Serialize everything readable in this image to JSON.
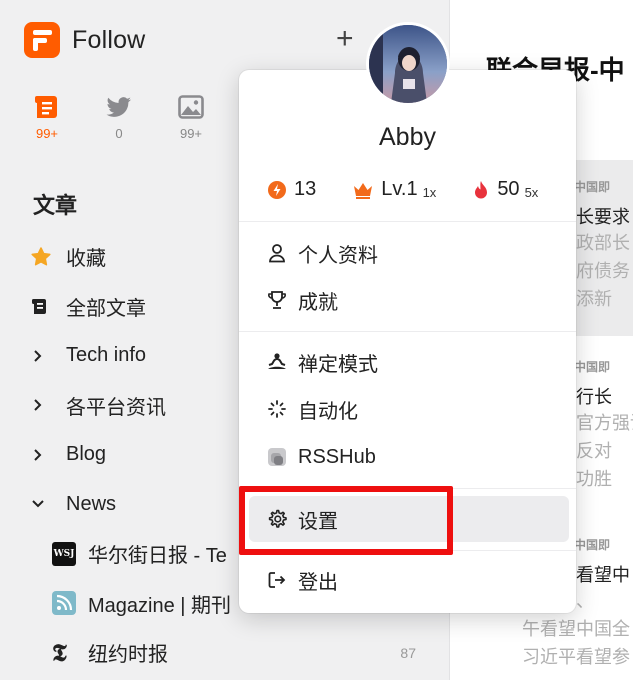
{
  "app": {
    "name": "Follow"
  },
  "views": [
    {
      "icon": "article-icon",
      "count": "99+",
      "active": true
    },
    {
      "icon": "twitter-icon",
      "count": "0"
    },
    {
      "icon": "picture-icon",
      "count": "99+"
    }
  ],
  "sidebar": {
    "section_title": "文章",
    "items": [
      {
        "label": "收藏",
        "icon": "star-icon"
      },
      {
        "label": "全部文章",
        "icon": "scroll-icon"
      },
      {
        "label": "Tech info",
        "icon": "chevron-right-icon"
      },
      {
        "label": "各平台资讯",
        "icon": "chevron-right-icon"
      },
      {
        "label": "Blog",
        "icon": "chevron-right-icon"
      },
      {
        "label": "News",
        "icon": "chevron-down-icon"
      },
      {
        "label": "华尔街日报 - Te",
        "icon": "wsj-icon"
      },
      {
        "label": "Magazine | 期刊",
        "icon": "rss-icon"
      },
      {
        "label": "纽约时报",
        "icon": "nyt-icon",
        "count": "87"
      }
    ]
  },
  "content": {
    "heading": "联合早报-中",
    "articles": [
      {
        "source": "联合早报-中国即",
        "title": "中国财长要求",
        "desc": [
          "中国财政部长",
          "地方政府债务",
          "期间再添新"
        ]
      },
      {
        "source": "联合早报-中国即",
        "title": "国央行行长",
        "desc": [
          "国央行官方强调",
          "经济，反对",
          "银行潘功胜"
        ]
      },
      {
        "source": "联合早报-中国即",
        "title": "习近平看望中",
        "desc": [
          "总书记、",
          "午看望中国全",
          "习近平看望参"
        ]
      }
    ]
  },
  "menu": {
    "user": "Abby",
    "stats": [
      {
        "icon": "power-icon",
        "value": "13",
        "mult": "",
        "color": "#f26a1b"
      },
      {
        "icon": "crown-icon",
        "value": "Lv.1",
        "mult": "1x",
        "color": "#f26a1b"
      },
      {
        "icon": "flame-icon",
        "value": "50",
        "mult": "5x",
        "color": "#e8323c"
      }
    ],
    "items": [
      {
        "label": "个人资料",
        "icon": "user-icon"
      },
      {
        "label": "成就",
        "icon": "trophy-icon"
      },
      {
        "label": "禅定模式",
        "icon": "meditation-icon"
      },
      {
        "label": "自动化",
        "icon": "magic-icon"
      },
      {
        "label": "RSSHub",
        "icon": "rsshub-icon"
      },
      {
        "label": "设置",
        "icon": "gear-icon"
      },
      {
        "label": "登出",
        "icon": "logout-icon"
      }
    ]
  },
  "colors": {
    "brand": "#ff5c00",
    "highlight_box": "#ee0f0f"
  }
}
